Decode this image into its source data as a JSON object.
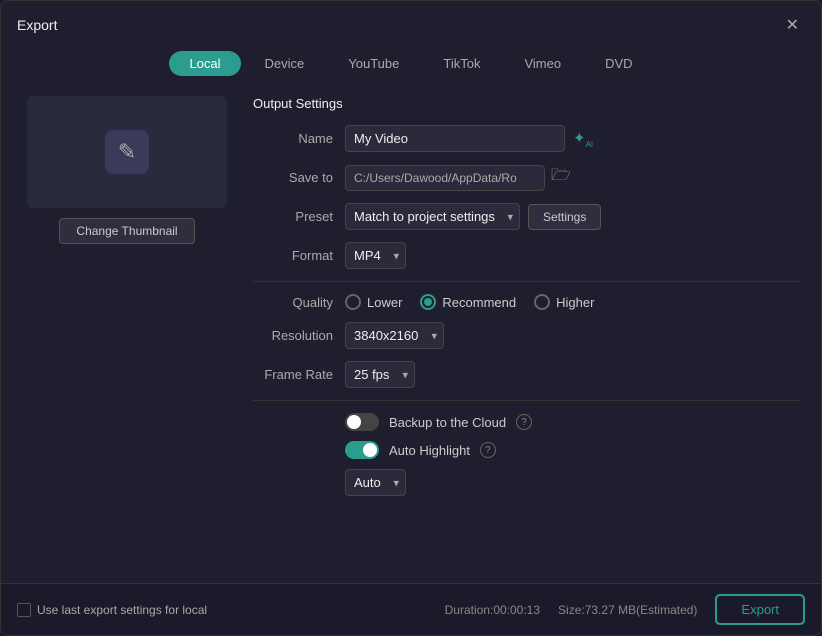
{
  "dialog": {
    "title": "Export",
    "close_label": "✕"
  },
  "tabs": [
    {
      "id": "local",
      "label": "Local",
      "active": true
    },
    {
      "id": "device",
      "label": "Device",
      "active": false
    },
    {
      "id": "youtube",
      "label": "YouTube",
      "active": false
    },
    {
      "id": "tiktok",
      "label": "TikTok",
      "active": false
    },
    {
      "id": "vimeo",
      "label": "Vimeo",
      "active": false
    },
    {
      "id": "dvd",
      "label": "DVD",
      "active": false
    }
  ],
  "thumbnail": {
    "change_label": "Change Thumbnail",
    "icon": "✎"
  },
  "output": {
    "section_title": "Output Settings",
    "name_label": "Name",
    "name_value": "My Video",
    "save_to_label": "Save to",
    "save_to_value": "C:/Users/Dawood/AppData/Ro",
    "preset_label": "Preset",
    "preset_value": "Match to project settings",
    "settings_label": "Settings",
    "format_label": "Format",
    "format_value": "MP4",
    "quality_label": "Quality",
    "quality_options": [
      {
        "id": "lower",
        "label": "Lower",
        "checked": false
      },
      {
        "id": "recommend",
        "label": "Recommend",
        "checked": true
      },
      {
        "id": "higher",
        "label": "Higher",
        "checked": false
      }
    ],
    "resolution_label": "Resolution",
    "resolution_value": "3840x2160",
    "framerate_label": "Frame Rate",
    "framerate_value": "25 fps",
    "backup_label": "Backup to the Cloud",
    "backup_on": false,
    "auto_highlight_label": "Auto Highlight",
    "auto_highlight_on": true,
    "auto_select_value": "Auto"
  },
  "footer": {
    "checkbox_label": "Use last export settings for local",
    "duration_label": "Duration:00:00:13",
    "size_label": "Size:73.27 MB(Estimated)",
    "export_label": "Export"
  }
}
